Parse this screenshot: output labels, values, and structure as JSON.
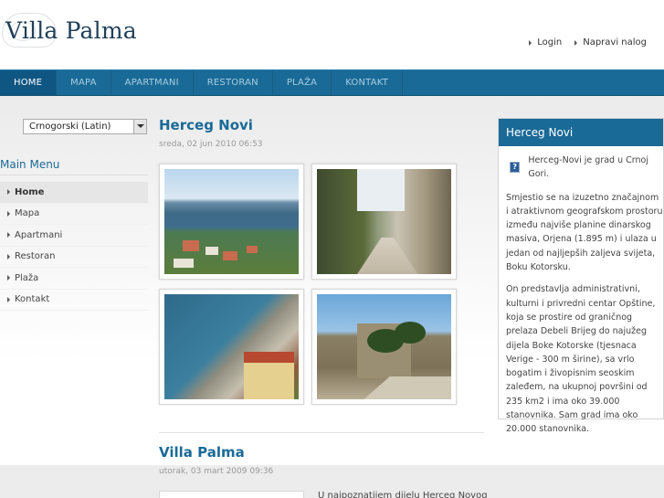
{
  "header": {
    "logo_text": "Villa Palma",
    "links": [
      "Login",
      "Napravi nalog"
    ]
  },
  "nav": {
    "items": [
      "HOME",
      "MAPA",
      "APARTMANI",
      "RESTORAN",
      "PLAŽA",
      "KONTAKT"
    ],
    "active": "HOME"
  },
  "sidebar": {
    "language_select": "Crnogorski (Latin)",
    "menu_title": "Main Menu",
    "menu_items": [
      "Home",
      "Mapa",
      "Apartmani",
      "Restoran",
      "Plaža",
      "Kontakt"
    ],
    "active_item": "Home"
  },
  "main": {
    "article1": {
      "title": "Herceg Novi",
      "date": "sreda, 02 jun 2010 06:53"
    },
    "article2": {
      "title": "Villa Palma",
      "date": "utorak, 03 mart 2009 09:36",
      "text_start": "U najpoznatijem dijelu Herceg Novog"
    }
  },
  "panel": {
    "title": "Herceg Novi",
    "intro": "Herceg-Novi je grad u Crnoj Gori.",
    "paragraphs": [
      "Smjestio se na izuzetno značajnom i atraktivnom geografskom prostoru između najviše planine dinarskog masiva, Orjena (1.895 m) i ulaza u jedan od najljepših zaljeva svijeta, Boku Kotorsku.",
      "On predstavlja administrativni, kulturni i privredni centar Opštine, koja se prostire od graničnog prelaza Debeli Brijeg do najužeg dijela Boke Kotorske (tjesnaca Verige - 300 m širine), sa vrlo bogatim i živopisnim seoskim zaleđem, na ukupnoj površini od 235 km2 i ima oko 39.000 stanovnika. Sam grad ima oko 20.000 stanovnika."
    ]
  },
  "colors": {
    "accent": "#1a6a97",
    "nav_active": "#0f5682"
  }
}
